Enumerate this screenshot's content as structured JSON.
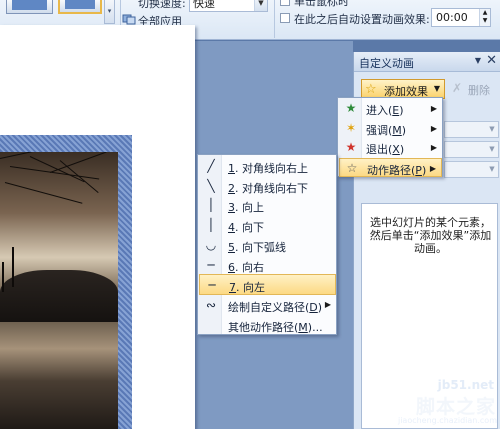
{
  "ribbon": {
    "speed_label": "切换速度:",
    "speed_value": "快速",
    "apply_all": "全部应用",
    "click_label": "单击鼠标时",
    "auto_label": "在此之后自动设置动画效果:",
    "auto_time": "00:00"
  },
  "pane": {
    "title": "自定义动画",
    "add_effect": "添加效果",
    "delete": "删除",
    "hint": "选中幻灯片的某个元素，然后单击“添加效果”添加动画。"
  },
  "effect_menu": [
    {
      "icon": "entrance-star-icon",
      "glyph": "★",
      "color": "#2e8b3a",
      "label": "进入",
      "key": "E"
    },
    {
      "icon": "emphasis-star-icon",
      "glyph": "✶",
      "color": "#e0a10a",
      "label": "强调",
      "key": "M"
    },
    {
      "icon": "exit-star-icon",
      "glyph": "★",
      "color": "#d0342c",
      "label": "退出",
      "key": "X"
    },
    {
      "icon": "motion-path-star-icon",
      "glyph": "☆",
      "color": "#555555",
      "label": "动作路径",
      "key": "P"
    }
  ],
  "path_menu": [
    {
      "icon": "diagonal-up-right-icon",
      "glyph": "╱",
      "num": "1",
      "label": ". 对角线向右上"
    },
    {
      "icon": "diagonal-down-right-icon",
      "glyph": "╲",
      "num": "2",
      "label": ". 对角线向右下"
    },
    {
      "icon": "path-up-icon",
      "glyph": "│",
      "num": "3",
      "label": ". 向上"
    },
    {
      "icon": "path-down-icon",
      "glyph": "│",
      "num": "4",
      "label": ". 向下"
    },
    {
      "icon": "arc-down-icon",
      "glyph": "◡",
      "num": "5",
      "label": ". 向下弧线"
    },
    {
      "icon": "path-right-icon",
      "glyph": "─",
      "num": "6",
      "label": ". 向右"
    },
    {
      "icon": "path-left-icon",
      "glyph": "─",
      "num": "7",
      "label": ". 向左"
    }
  ],
  "path_extra": {
    "draw_custom": "绘制自定义路径(",
    "draw_key": "D",
    "draw_close": ")",
    "other_paths": "其他动作路径(",
    "other_key": "M",
    "other_close": ")..."
  },
  "watermark": {
    "site": "jb51.net",
    "name": "脚本之家",
    "url": "jiaocheng.chazidian.com"
  }
}
